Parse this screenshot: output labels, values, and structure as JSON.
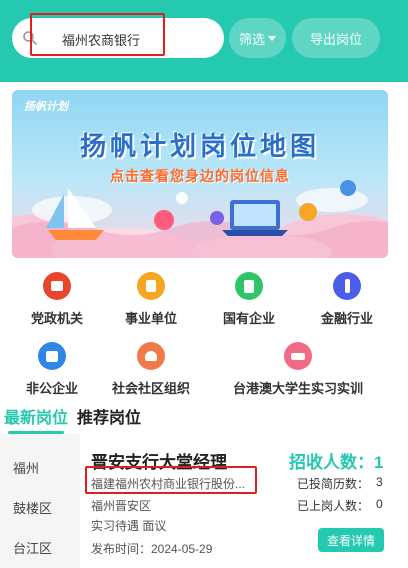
{
  "header": {
    "search_value": "福州农商银行",
    "filter_label": "筛选",
    "export_label": "导出岗位"
  },
  "banner": {
    "logo_text": "扬帆计划",
    "title": "扬帆计划岗位地图",
    "subtitle": "点击查看您身边的岗位信息"
  },
  "categories": [
    {
      "label": "党政机关",
      "color": "#e8452c"
    },
    {
      "label": "事业单位",
      "color": "#f5a623"
    },
    {
      "label": "国有企业",
      "color": "#2fc46a"
    },
    {
      "label": "金融行业",
      "color": "#4a5ee8"
    },
    {
      "label": "非公企业",
      "color": "#2f86e6"
    },
    {
      "label": "社会社区组织",
      "color": "#f07a4a"
    },
    {
      "label": "台港澳大学生实习实训",
      "color": "#f26b86"
    }
  ],
  "tabs": {
    "latest": "最新岗位",
    "recommended": "推荐岗位"
  },
  "districts": [
    "福州",
    "鼓楼区",
    "台江区"
  ],
  "job": {
    "title": "晋安支行大堂经理",
    "recruit_count_label": "招收人数：1",
    "company": "福建福州农村商业银行股份...",
    "district": "福州晋安区",
    "benefits": "实习待遇 面议",
    "publish_time": "发布时间：2024-05-29",
    "resume_count_label": "已投简历数：",
    "resume_count": "3",
    "onboard_count_label": "已上岗人数：",
    "onboard_count": "0",
    "detail_button": "查看详情"
  }
}
